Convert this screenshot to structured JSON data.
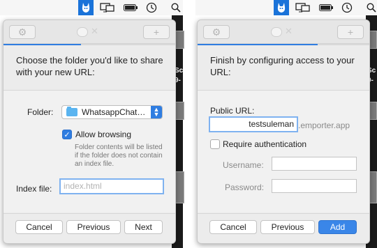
{
  "colors": {
    "accent": "#2f7de1",
    "menubar_app": "#1a73d9"
  },
  "menubar": {
    "icons": [
      "emporter-app-icon",
      "display-icon",
      "battery-icon",
      "clock-icon",
      "search-icon"
    ]
  },
  "left_panel": {
    "progress": 0.45,
    "headline": "Choose the folder you'd like to share with your new URL:",
    "folder_label": "Folder:",
    "folder_value": "WhatsappChat…",
    "allow_browsing_label": "Allow browsing",
    "allow_browsing_checked": true,
    "help_text": "Folder contents will be listed if the folder does not contain an index file.",
    "index_label": "Index file:",
    "index_placeholder": "index.html",
    "buttons": {
      "cancel": "Cancel",
      "previous": "Previous",
      "next": "Next"
    }
  },
  "right_panel": {
    "progress": 0.7,
    "headline": "Finish by configuring access to your URL:",
    "public_url_label": "Public URL:",
    "public_url_value": "testsuleman",
    "public_url_suffix": ".emporter.app",
    "require_auth_label": "Require authentication",
    "require_auth_checked": false,
    "username_label": "Username:",
    "password_label": "Password:",
    "buttons": {
      "cancel": "Cancel",
      "previous": "Previous",
      "add": "Add"
    }
  },
  "background_text": {
    "line1": "Sc",
    "line2": "9-"
  }
}
